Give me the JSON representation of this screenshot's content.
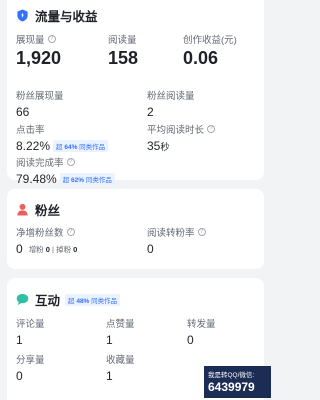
{
  "traffic": {
    "title": "流量与收益",
    "icon": "shield-blue-icon",
    "impressions": {
      "label": "展现量",
      "value": "1,920"
    },
    "reads": {
      "label": "阅读量",
      "value": "158"
    },
    "earnings": {
      "label": "创作收益(元)",
      "value": "0.06"
    },
    "fan_impressions": {
      "label": "粉丝展现量",
      "value": "66"
    },
    "fan_reads": {
      "label": "粉丝阅读量",
      "value": "2"
    },
    "ctr": {
      "label": "点击率",
      "value": "8.22",
      "unit": "%",
      "badge_prefix": "超",
      "badge_pct": "64%",
      "badge_suffix": "同类作品"
    },
    "avg_read_time": {
      "label": "平均阅读时长",
      "value": "35",
      "unit": "秒"
    },
    "completion": {
      "label": "阅读完成率",
      "value": "79.48",
      "unit": "%",
      "badge_prefix": "超",
      "badge_pct": "62%",
      "badge_suffix": "同类作品"
    }
  },
  "fans": {
    "title": "粉丝",
    "icon": "person-icon",
    "net_gain": {
      "label": "净增粉丝数",
      "value": "0",
      "gain_label": "增粉",
      "gain_value": "0",
      "loss_label": "掉粉",
      "loss_value": "0"
    },
    "conversion": {
      "label": "阅读转粉率",
      "value": "0"
    }
  },
  "interact": {
    "title": "互动",
    "icon": "chat-bubble-icon",
    "badge_prefix": "超",
    "badge_pct": "48%",
    "badge_suffix": "同类作品",
    "comments": {
      "label": "评论量",
      "value": "1"
    },
    "likes": {
      "label": "点赞量",
      "value": "1"
    },
    "reposts": {
      "label": "转发量",
      "value": "0"
    },
    "shares": {
      "label": "分享量",
      "value": "0"
    },
    "favorites": {
      "label": "收藏量",
      "value": "1"
    }
  },
  "watermark": {
    "line1": "我是转QQ/微信:",
    "line2": "6439979"
  },
  "colors": {
    "accent": "#3370ff",
    "fan_icon": "#e8615a",
    "chat_icon": "#2fbfa5"
  }
}
